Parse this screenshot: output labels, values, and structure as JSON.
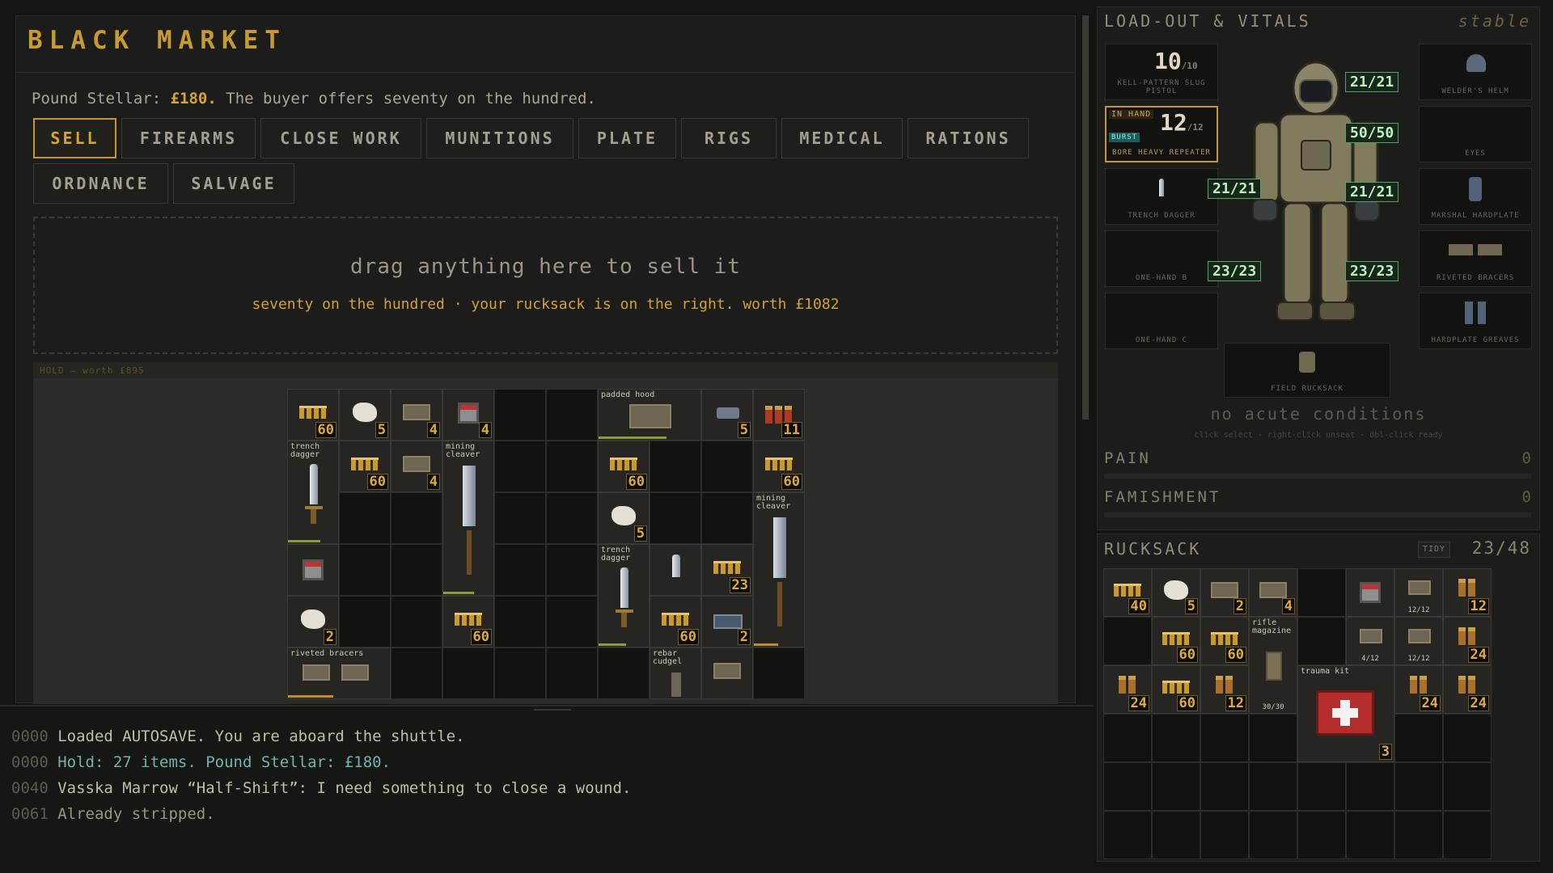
{
  "market": {
    "title": "BLACK MARKET",
    "currency_label": "Pound Stellar:",
    "currency_value": "£180.",
    "offer_text": "The buyer offers seventy on the hundred.",
    "tabs": [
      "SELL",
      "FIREARMS",
      "CLOSE WORK",
      "MUNITIONS",
      "PLATE",
      "RIGS",
      "MEDICAL",
      "RATIONS",
      "ORDNANCE",
      "SALVAGE"
    ],
    "active_tab": "SELL",
    "drop_message": "drag anything here to sell it",
    "drop_sub": "seventy on the hundred · your rucksack is on the right. worth £1082",
    "hold_label": "HOLD — worth £895",
    "hold_items": [
      {
        "icon": "ammo-icon",
        "qty": "60"
      },
      {
        "icon": "cloth-icon",
        "qty": "5"
      },
      {
        "icon": "plate-icon",
        "qty": "4"
      },
      {
        "icon": "medkit-icon",
        "qty": "4"
      },
      {
        "name": "padded hood"
      },
      {
        "icon": "pistol-icon",
        "qty": "5"
      },
      {
        "icon": "shell-icon",
        "qty": "11"
      },
      {
        "name": "trench dagger"
      },
      {
        "icon": "ammo-icon",
        "qty": "60"
      },
      {
        "icon": "plate-icon",
        "qty": "4"
      },
      {
        "name": "mining cleaver"
      },
      {
        "icon": "ammo-icon",
        "qty": "60"
      },
      {
        "icon": "ammo-icon",
        "qty": "60"
      },
      {
        "name": "mining cleaver"
      },
      {
        "icon": "cloth-icon",
        "qty": "5"
      },
      {
        "name": "trench dagger"
      },
      {
        "icon": "knife-icon"
      },
      {
        "icon": "ammo-icon",
        "qty": "23"
      },
      {
        "icon": "medkit-icon"
      },
      {
        "icon": "cloth-icon",
        "qty": "2"
      },
      {
        "icon": "ammo-icon",
        "qty": "60"
      },
      {
        "icon": "ammo-icon",
        "qty": "60"
      },
      {
        "icon": "tin-icon",
        "qty": "2"
      },
      {
        "name": "riveted bracers"
      },
      {
        "name": "rebar cudgel"
      },
      {
        "icon": "plate-icon"
      }
    ]
  },
  "console": {
    "lines": [
      {
        "time": "0000",
        "text": "Loaded AUTOSAVE. You are aboard the shuttle."
      },
      {
        "time": "0000",
        "text": "Hold: 27 items. Pound Stellar: £180."
      },
      {
        "time": "0040",
        "text": "Vasska Marrow “Half-Shift”: I need something to close a wound."
      },
      {
        "time": "0061",
        "text": "Already stripped."
      }
    ]
  },
  "loadout": {
    "title": "LOAD-OUT & VITALS",
    "status": "stable",
    "left_slots": [
      {
        "label": "KELL-PATTERN SLUG PISTOL",
        "ammo": "10",
        "ammo_max": "/10"
      },
      {
        "label": "BORE HEAVY REPEATER",
        "ammo": "12",
        "ammo_max": "/12",
        "in_hand": "IN HAND",
        "mode": "BURST"
      },
      {
        "label": "TRENCH DAGGER"
      },
      {
        "label": "ONE-HAND B"
      },
      {
        "label": "ONE-HAND C"
      }
    ],
    "right_slots": [
      {
        "label": "WELDER'S HELM"
      },
      {
        "label": "EYES"
      },
      {
        "label": "MARSHAL HARDPLATE"
      },
      {
        "label": "RIVETED BRACERS"
      },
      {
        "label": "HARDPLATE GREAVES"
      }
    ],
    "backpack_label": "FIELD RUCKSACK",
    "hp": {
      "head": "21/21",
      "torso": "50/50",
      "left_arm": "21/21",
      "right_arm": "21/21",
      "left_leg": "23/23",
      "right_leg": "23/23"
    },
    "conditions": "no acute conditions",
    "hint": "click select · right-click unseat · dbl-click ready",
    "stats": [
      {
        "label": "PAIN",
        "value": "0",
        "fraction": 0
      },
      {
        "label": "FAMISHMENT",
        "value": "0",
        "fraction": 0
      }
    ]
  },
  "rucksack": {
    "title": "RUCKSACK",
    "tidy_label": "TIDY",
    "count": "23/48",
    "items": [
      {
        "icon": "ammo-icon",
        "qty": "40"
      },
      {
        "icon": "cloth-icon",
        "qty": "5"
      },
      {
        "icon": "plate-icon",
        "qty": "2"
      },
      {
        "icon": "plate-icon",
        "qty": "4"
      },
      {
        "icon": "medkit-icon"
      },
      {
        "icon": "plate-icon",
        "label": "12/12"
      },
      {
        "icon": "shell-icon",
        "qty": "12"
      },
      {
        "icon": "ammo-icon",
        "qty": "60"
      },
      {
        "icon": "ammo-icon",
        "qty": "60"
      },
      {
        "name": "rifle magazine",
        "label": "30/30"
      },
      {
        "icon": "plate-icon",
        "label": "4/12"
      },
      {
        "icon": "plate-icon",
        "label": "12/12"
      },
      {
        "icon": "shell-icon",
        "qty": "24"
      },
      {
        "icon": "shell-icon",
        "qty": "24"
      },
      {
        "icon": "ammo-icon",
        "qty": "60"
      },
      {
        "icon": "shell-icon",
        "qty": "12"
      },
      {
        "name": "trauma kit",
        "qty": "3"
      },
      {
        "icon": "shell-icon",
        "qty": "24"
      },
      {
        "icon": "shell-icon",
        "qty": "24"
      }
    ]
  }
}
